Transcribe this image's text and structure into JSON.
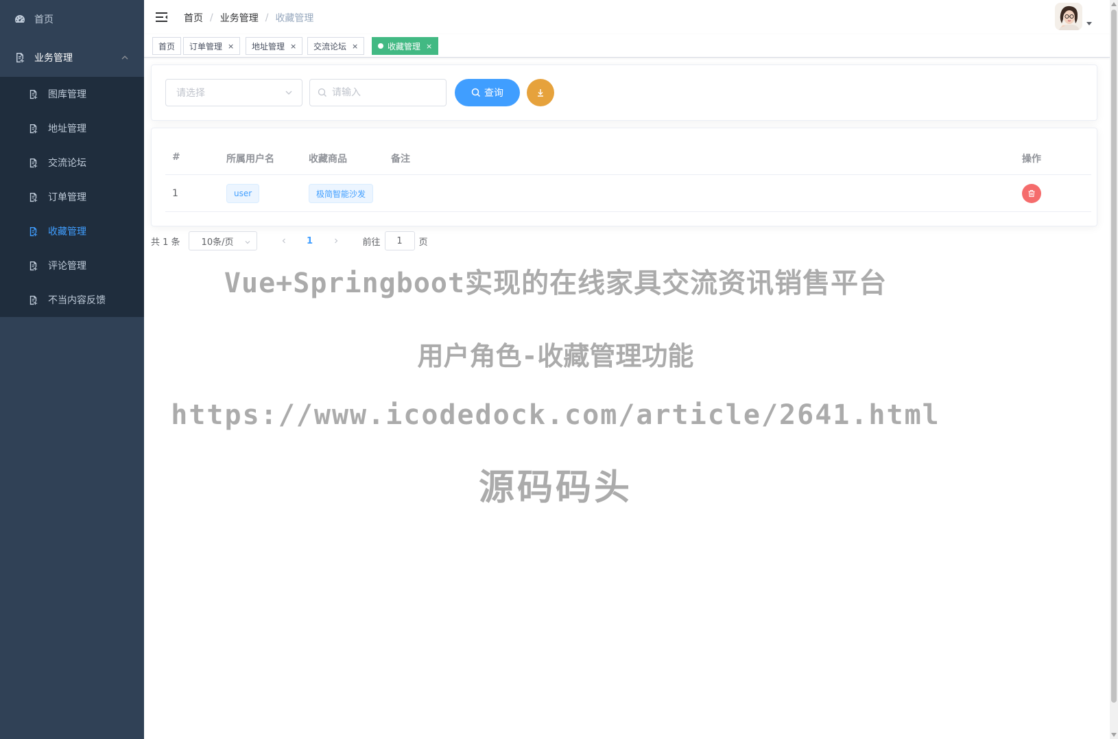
{
  "sidebar": {
    "home": {
      "label": "首页",
      "icon": "dashboard-icon"
    },
    "group": {
      "label": "业务管理",
      "icon": "document-icon",
      "expanded": true
    },
    "items": [
      {
        "label": "图库管理",
        "icon": "document-icon",
        "active": false
      },
      {
        "label": "地址管理",
        "icon": "document-icon",
        "active": false
      },
      {
        "label": "交流论坛",
        "icon": "document-icon",
        "active": false
      },
      {
        "label": "订单管理",
        "icon": "document-icon",
        "active": false
      },
      {
        "label": "收藏管理",
        "icon": "document-icon",
        "active": true
      },
      {
        "label": "评论管理",
        "icon": "document-icon",
        "active": false
      },
      {
        "label": "不当内容反馈",
        "icon": "document-icon",
        "active": false
      }
    ],
    "colors": {
      "bg": "#304156",
      "submenu_bg": "#1f2d3d",
      "text": "#bfcbd9",
      "active": "#409eff"
    }
  },
  "navbar": {
    "breadcrumb": [
      "首页",
      "业务管理",
      "收藏管理"
    ],
    "separator": "/"
  },
  "tags": [
    {
      "label": "首页",
      "closable": false,
      "active": false
    },
    {
      "label": "订单管理",
      "closable": true,
      "active": false
    },
    {
      "label": "地址管理",
      "closable": true,
      "active": false
    },
    {
      "label": "交流论坛",
      "closable": true,
      "active": false
    },
    {
      "label": "收藏管理",
      "closable": true,
      "active": true
    }
  ],
  "tag_close_glyph": "×",
  "filters": {
    "select_placeholder": "请选择",
    "search_placeholder": "请输入",
    "query_label": "查询"
  },
  "table": {
    "columns": [
      "#",
      "所属用户名",
      "收藏商品",
      "备注",
      "操作"
    ],
    "rows": [
      {
        "index": "1",
        "username": "user",
        "product": "极简智能沙发",
        "remark": ""
      }
    ]
  },
  "pagination": {
    "total_text": "共 1 条",
    "page_size": "10条/页",
    "current_page": "1",
    "goto_prefix": "前往",
    "goto_value": "1",
    "goto_suffix": "页"
  },
  "watermark": [
    "Vue+Springboot实现的在线家具交流资讯销售平台",
    "用户角色-收藏管理功能",
    "https://www.icodedock.com/article/2641.html",
    "源码码头"
  ],
  "colors": {
    "primary": "#409eff",
    "success_tag": "#42b983",
    "warning": "#e6a23c",
    "danger": "#f56c6c"
  }
}
